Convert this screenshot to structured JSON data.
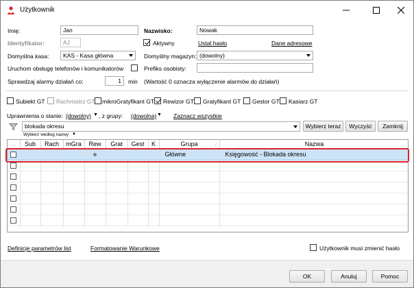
{
  "window": {
    "title": "Użytkownik",
    "accent": "#d9232d"
  },
  "form": {
    "imie_label": "Imię:",
    "imie_value": "Jan",
    "nazwisko_label": "Nazwisko:",
    "nazwisko_value": "Nowak",
    "identyfikator_label": "Identyfikator:",
    "identyfikator_value": "AJ",
    "aktywny_label": "Aktywny",
    "aktywny_checked": true,
    "ustal_haslo": "Ustal hasło",
    "dane_adresowe": "Dane adresowe",
    "domyslna_kasa_label": "Domyślna kasa:",
    "domyslna_kasa_value": "KAS - Kasa główna",
    "domyslny_magazyn_label": "Domyślny magazyn:",
    "domyslny_magazyn_value": "(dowolny)",
    "uruchom_label": "Uruchom obsługę telefonów i komunikatorów",
    "prefiks_label": "Prefiks osobisty:",
    "prefiks_value": "",
    "sprawdzaj_label": "Sprawdzaj alarmy działań co:",
    "sprawdzaj_value": "1",
    "min_label": "min",
    "alarm_note": "(Wartość 0 oznacza wyłączenie alarmów do działań)"
  },
  "modules": [
    {
      "label": "Subiekt GT",
      "checked": false,
      "disabled": false
    },
    {
      "label": "Rachmistrz GT",
      "checked": false,
      "disabled": true
    },
    {
      "label": "mikroGratyfikant GT",
      "checked": false,
      "disabled": false
    },
    {
      "label": "Rewizor GT",
      "checked": true,
      "disabled": false
    },
    {
      "label": "Gratyfikant GT",
      "checked": false,
      "disabled": false
    },
    {
      "label": "Gestor GT",
      "checked": false,
      "disabled": false
    },
    {
      "label": "Kasiarz GT",
      "checked": false,
      "disabled": false
    }
  ],
  "permissions": {
    "stan_label": "Uprawnienia o stanie:",
    "stan_value": "(dowolny)",
    "grupy_label": ", z grupy:",
    "grupy_value": "(dowolna)",
    "zaznacz_wszystkie": "Zaznacz wszystkie",
    "search_value": "blokada okresu",
    "wybierz_wedlug": "Wybierz według nazwy",
    "wybierz_teraz": "Wybierz teraz",
    "wyczysc": "Wyczyść",
    "zamknij": "Zamknij"
  },
  "grid": {
    "columns": [
      "",
      "Sub",
      "Rach",
      "mGra",
      "Rew",
      "Grat",
      "Gest",
      "K",
      "Grupa",
      "Nazwa"
    ],
    "rows": [
      {
        "selected": true,
        "rew_dot": true,
        "grupa": "Główne",
        "nazwa": "Księgowość - Blokada okresu"
      },
      {
        "selected": false,
        "rew_dot": false,
        "grupa": "",
        "nazwa": ""
      },
      {
        "selected": false,
        "rew_dot": false,
        "grupa": "",
        "nazwa": ""
      },
      {
        "selected": false,
        "rew_dot": false,
        "grupa": "",
        "nazwa": ""
      },
      {
        "selected": false,
        "rew_dot": false,
        "grupa": "",
        "nazwa": ""
      },
      {
        "selected": false,
        "rew_dot": false,
        "grupa": "",
        "nazwa": ""
      },
      {
        "selected": false,
        "rew_dot": false,
        "grupa": "",
        "nazwa": ""
      }
    ]
  },
  "links": {
    "definicje": "Definicje parametrów list",
    "formatowanie": "Formatowanie Warunkowe",
    "zmienic_haslo": "Użytkownik musi zmienić hasło"
  },
  "buttons": {
    "ok": "OK",
    "anuluj": "Anuluj",
    "pomoc": "Pomoc"
  }
}
